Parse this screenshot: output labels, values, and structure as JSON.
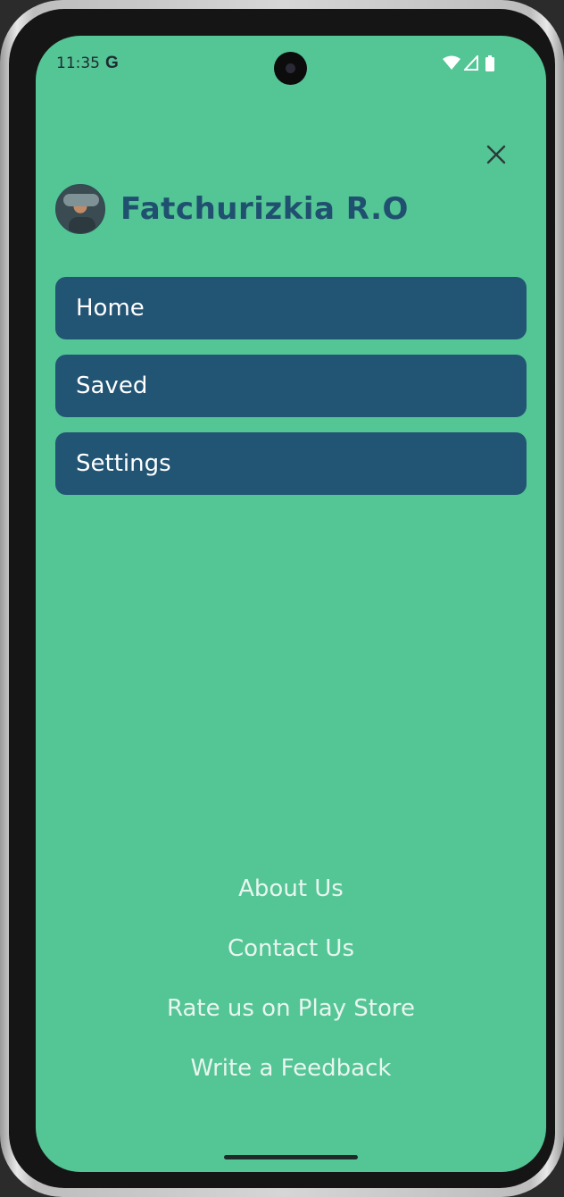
{
  "status_bar": {
    "time": "11:35",
    "g_label": "G",
    "icons": [
      "wifi-icon",
      "signal-icon",
      "battery-icon"
    ]
  },
  "drawer": {
    "close_icon": "close-icon",
    "user_name": "Fatchurizkia R.O",
    "menu_items": [
      {
        "label": "Home"
      },
      {
        "label": "Saved"
      },
      {
        "label": "Settings"
      }
    ],
    "footer_links": [
      {
        "label": "About Us"
      },
      {
        "label": "Contact Us"
      },
      {
        "label": "Rate us on Play Store"
      },
      {
        "label": "Write a Feedback"
      }
    ]
  },
  "colors": {
    "background": "#54c595",
    "menu_item": "#225474",
    "name_text": "#20506f",
    "footer_text": "#e8f6ef"
  }
}
